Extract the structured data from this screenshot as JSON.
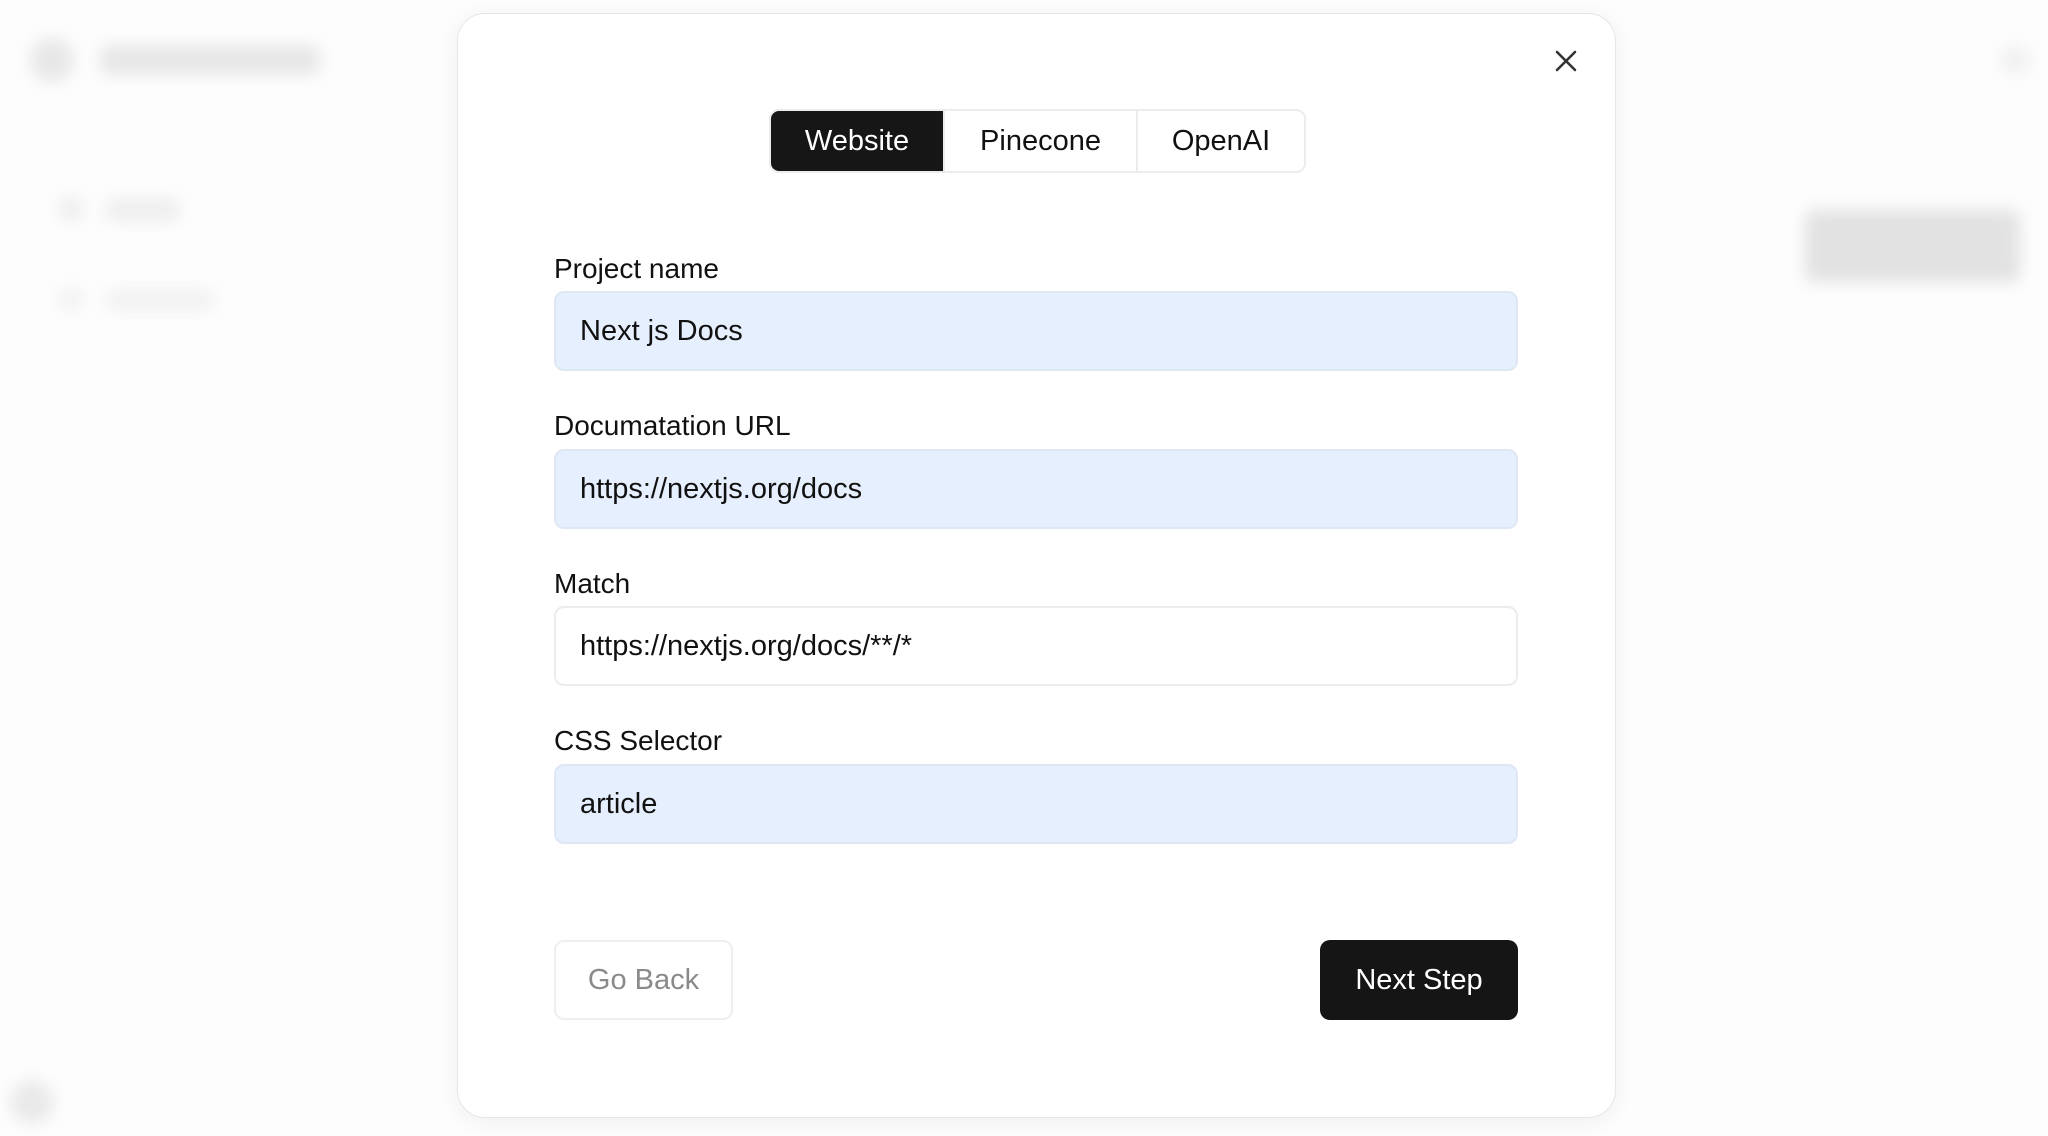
{
  "modal": {
    "tabs": [
      {
        "label": "Website",
        "active": true
      },
      {
        "label": "Pinecone",
        "active": false
      },
      {
        "label": "OpenAI",
        "active": false
      }
    ],
    "fields": [
      {
        "label": "Project name",
        "value": "Next js Docs",
        "autofilled": true
      },
      {
        "label": "Documatation URL",
        "value": "https://nextjs.org/docs",
        "autofilled": true
      },
      {
        "label": "Match",
        "value": "https://nextjs.org/docs/**/*",
        "autofilled": false
      },
      {
        "label": "CSS Selector",
        "value": "article",
        "autofilled": true
      }
    ],
    "back_label": "Go Back",
    "next_label": "Next Step",
    "close_icon": "close-icon"
  },
  "colors": {
    "primary": "#151515",
    "autofill": "#e6effd"
  }
}
